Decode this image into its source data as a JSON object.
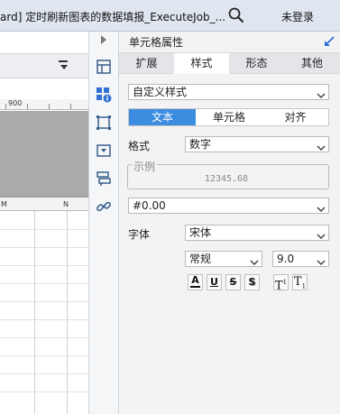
{
  "window": {
    "title": "ard] 定时刷新图表的数据填报_ExecuteJob_...",
    "login_label": "未登录"
  },
  "editor": {
    "ruler_mark": "900",
    "column_header_left": "M",
    "column_header_right": "N"
  },
  "icon_strip": {
    "items": [
      "cell-format-icon",
      "cell-attributes-icon",
      "border-icon",
      "dropdown-widget-icon",
      "condition-icon",
      "hyperlink-icon"
    ]
  },
  "panel": {
    "title": "单元格属性",
    "tabs": [
      {
        "label": "扩展",
        "active": false
      },
      {
        "label": "样式",
        "active": true
      },
      {
        "label": "形态",
        "active": false
      },
      {
        "label": "其他",
        "active": false
      }
    ],
    "style_select": "自定义样式",
    "subtabs": [
      {
        "label": "文本",
        "active": true
      },
      {
        "label": "单元格",
        "active": false
      },
      {
        "label": "对齐",
        "active": false
      }
    ],
    "format_label": "格式",
    "format_value": "数字",
    "example_legend": "示例",
    "example_value": "12345.68",
    "pattern_value": "#0.00",
    "font_label": "字体",
    "font_value": "宋体",
    "font_style_value": "常规",
    "font_size_value": "9.0",
    "format_buttons": {
      "color": "A",
      "underline": "U",
      "strike": "S",
      "shadow": "S",
      "superscript": "T",
      "superscript_mark": "1",
      "subscript": "T",
      "subscript_mark": "1"
    }
  },
  "colors": {
    "accent": "#3c8de0",
    "titlebar": "#dfe6ef",
    "panel_bg": "#f3f3f3"
  }
}
